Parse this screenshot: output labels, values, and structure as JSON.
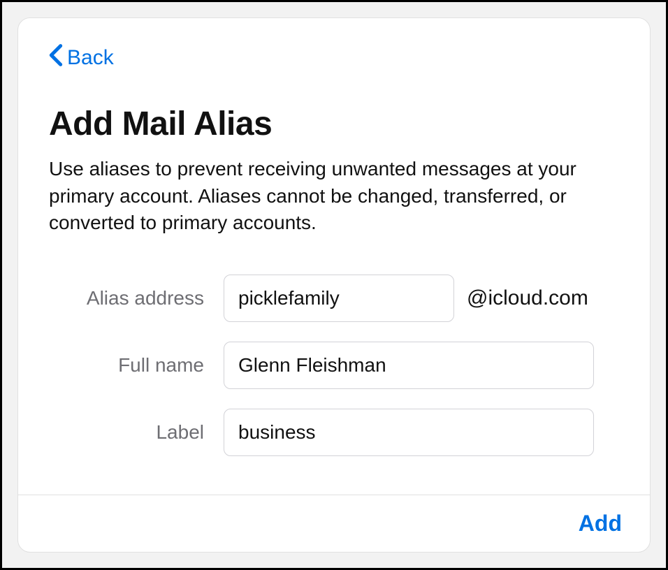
{
  "nav": {
    "back_label": "Back"
  },
  "header": {
    "title": "Add Mail Alias",
    "description": "Use aliases to prevent receiving unwanted messages at your primary account. Aliases cannot be changed, transferred, or converted to primary accounts."
  },
  "form": {
    "alias": {
      "label": "Alias address",
      "value": "picklefamily",
      "suffix": "@icloud.com"
    },
    "fullname": {
      "label": "Full name",
      "value": "Glenn Fleishman"
    },
    "label_field": {
      "label": "Label",
      "value": "business"
    }
  },
  "footer": {
    "add_label": "Add"
  },
  "colors": {
    "accent": "#0071e3"
  }
}
